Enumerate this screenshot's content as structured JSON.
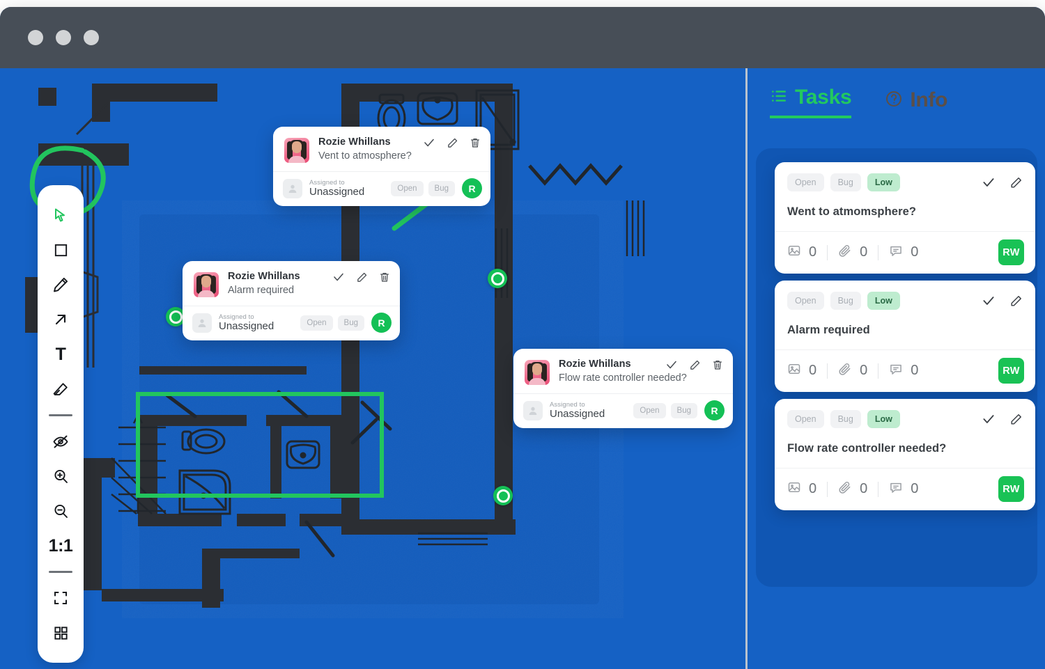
{
  "window": {
    "traffic_lights": [
      "close",
      "minimize",
      "maximize"
    ]
  },
  "toolbar": {
    "tools": [
      {
        "name": "select-tool",
        "icon": "cursor-icon",
        "active": true
      },
      {
        "name": "rectangle-tool",
        "icon": "square-icon",
        "active": false
      },
      {
        "name": "pen-tool",
        "icon": "pencil-icon",
        "active": false
      },
      {
        "name": "arrow-tool",
        "icon": "arrow-up-right-icon",
        "active": false
      },
      {
        "name": "text-tool",
        "icon": "text-icon",
        "label": "T",
        "active": false
      },
      {
        "name": "eraser-tool",
        "icon": "eraser-icon",
        "active": false
      },
      {
        "name": "hide-annotations-tool",
        "icon": "eye-off-icon",
        "active": false
      },
      {
        "name": "zoom-in-tool",
        "icon": "zoom-in-icon",
        "active": false
      },
      {
        "name": "zoom-out-tool",
        "icon": "zoom-out-icon",
        "active": false
      },
      {
        "name": "zoom-reset-tool",
        "icon": "one-to-one-icon",
        "label": "1:1",
        "active": false
      },
      {
        "name": "fit-screen-tool",
        "icon": "fit-screen-icon",
        "active": false
      },
      {
        "name": "grid-view-tool",
        "icon": "grid-icon",
        "active": false
      }
    ]
  },
  "canvas": {
    "background_color": "#1561C4",
    "annotation_color": "#22C55E",
    "popups": [
      {
        "author": "Rozie Whillans",
        "message": "Vent to atmosphere?",
        "assigned_label": "Assigned to",
        "assigned_value": "Unassigned",
        "tags": [
          "Open",
          "Bug"
        ],
        "avatar_initial": "R"
      },
      {
        "author": "Rozie Whillans",
        "message": "Alarm required",
        "assigned_label": "Assigned to",
        "assigned_value": "Unassigned",
        "tags": [
          "Open",
          "Bug"
        ],
        "avatar_initial": "R"
      },
      {
        "author": "Rozie Whillans",
        "message": "Flow rate controller needed?",
        "assigned_label": "Assigned to",
        "assigned_value": "Unassigned",
        "tags": [
          "Open",
          "Bug"
        ],
        "avatar_initial": "R"
      }
    ]
  },
  "sidebar": {
    "tabs": [
      {
        "label": "Tasks",
        "icon": "list-icon",
        "active": true,
        "color": "#22C95F"
      },
      {
        "label": "Info",
        "icon": "question-circle-icon",
        "active": false,
        "color": "#5B4F48"
      }
    ],
    "tasks": [
      {
        "tags": [
          "Open",
          "Bug",
          "Low"
        ],
        "title": "Went to  atmomsphere?",
        "images": "0",
        "attachments": "0",
        "comments": "0",
        "assignee_initials": "RW"
      },
      {
        "tags": [
          "Open",
          "Bug",
          "Low"
        ],
        "title": "Alarm required",
        "images": "0",
        "attachments": "0",
        "comments": "0",
        "assignee_initials": "RW"
      },
      {
        "tags": [
          "Open",
          "Bug",
          "Low"
        ],
        "title": "Flow rate controller needed?",
        "images": "0",
        "attachments": "0",
        "comments": "0",
        "assignee_initials": "RW"
      }
    ]
  }
}
